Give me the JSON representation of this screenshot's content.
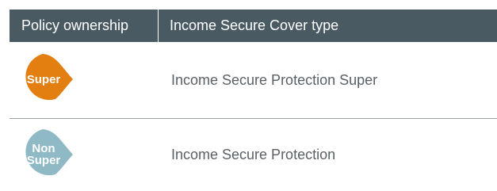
{
  "table": {
    "headers": [
      "Policy ownership",
      "Income Secure Cover type"
    ],
    "rows": [
      {
        "badge_lines": [
          "Super"
        ],
        "cover_type": "Income Secure Protection Super",
        "badge_color": "#e37e10"
      },
      {
        "badge_lines": [
          "Non",
          "Super"
        ],
        "cover_type": "Income Secure Protection",
        "badge_color": "#8fb9c4"
      }
    ]
  },
  "colors": {
    "header_bg": "#4a5a62",
    "header_text": "#ffffff",
    "body_text": "#5a6166",
    "divider": "#9aa3a8"
  }
}
